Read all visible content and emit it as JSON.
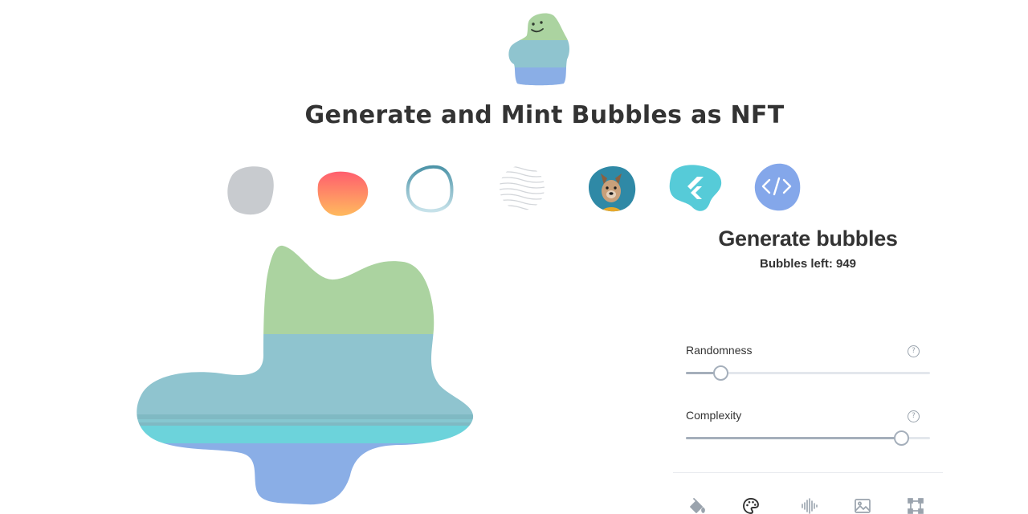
{
  "header": {
    "title": "Generate and Mint Bubbles as NFT",
    "logo_icon": "bubble-mascot-icon"
  },
  "style_options": [
    {
      "name": "solid-gray-bubble",
      "color": "#c8cbcf"
    },
    {
      "name": "gradient-bubble",
      "colors": [
        "#ff5e6e",
        "#ffba5e"
      ]
    },
    {
      "name": "outline-bubble",
      "colors": [
        "#4d94a8",
        "#c7e2ea"
      ]
    },
    {
      "name": "wavy-lines-bubble",
      "color": "#d3d6da"
    },
    {
      "name": "image-bubble",
      "subject": "french-bulldog"
    },
    {
      "name": "flutter-bubble",
      "color": "#56cbd8"
    },
    {
      "name": "code-bubble",
      "color": "#84a7ea"
    }
  ],
  "preview": {
    "stripe_colors": [
      "#abd3a0",
      "#8fc4cf",
      "#6cd3db",
      "#8aaee6"
    ]
  },
  "panel": {
    "title": "Generate bubbles",
    "bubbles_left": "Bubbles left: 949",
    "sliders": [
      {
        "label": "Randomness",
        "value": 0.14
      },
      {
        "label": "Complexity",
        "value": 0.88
      }
    ],
    "tabs": [
      "paint-bucket-icon",
      "palette-icon",
      "waveform-icon",
      "image-icon",
      "frame-icon"
    ],
    "active_tab": "palette-icon"
  },
  "colors": {
    "text": "#333333",
    "slider_fill": "#a5afbb",
    "slider_track": "#e3e7ec"
  }
}
